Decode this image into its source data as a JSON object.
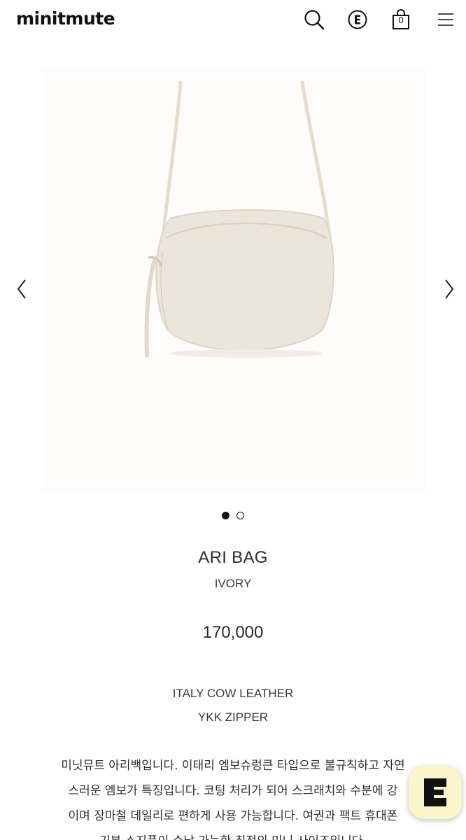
{
  "header": {
    "logo": "minitmute",
    "cart_count": "0"
  },
  "icons": {
    "search": "search-icon",
    "brand": "e-brand-icon",
    "cart": "shopping-bag-icon",
    "menu": "hamburger-menu-icon",
    "prev": "chevron-left-icon",
    "next": "chevron-right-icon"
  },
  "gallery": {
    "image": "ivory oval crossbody bag product photo",
    "slides_total": 2,
    "active_slide": 1
  },
  "product": {
    "name": "ARI BAG",
    "color": "IVORY",
    "price": "170,000",
    "spec_material": "ITALY COW LEATHER",
    "spec_zipper": "YKK ZIPPER",
    "description_lines": [
      "미닛뮤트 아리백입니다. 이태리 엠보슈렁큰 타입으로 불규칙하고 자연",
      "스러운 엠보가 특징입니다. 코팅 처리가 되어 스크래치와 수분에 강",
      "이며 장마철 데일리로 편하게 사용 가능합니다. 여권과 팩트 휴대폰",
      "기본 소지품이 수납 가능한 최적의 미니 사이즈입니다."
    ]
  },
  "colors": {
    "bag": "#ece6da",
    "text": "#2b2b2b",
    "fab_bg": "#fbf5cc"
  }
}
